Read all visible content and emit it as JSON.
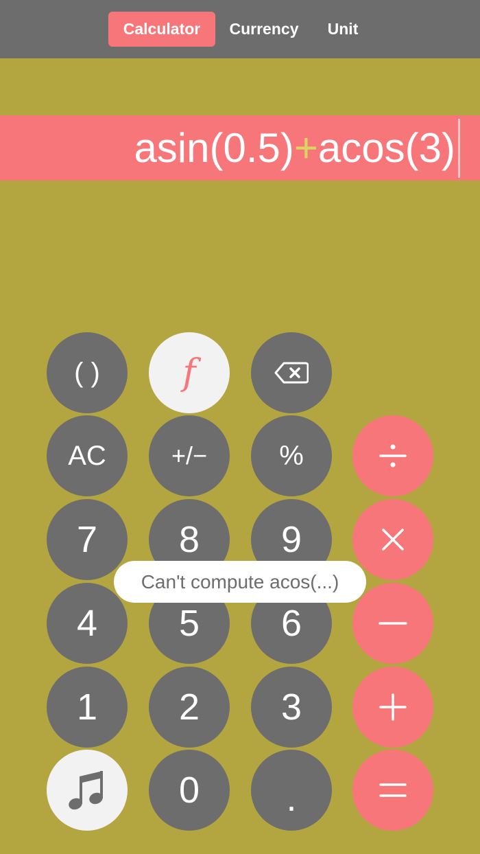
{
  "tabs": [
    {
      "label": "Calculator",
      "active": true
    },
    {
      "label": "Currency",
      "active": false
    },
    {
      "label": "Unit",
      "active": false
    }
  ],
  "display": {
    "part1": "asin(0.5)",
    "operator": "+",
    "part2": "acos(3)"
  },
  "keys": {
    "parens": "( )",
    "function": "f",
    "clear": "AC",
    "plus_minus": "+/−",
    "percent": "%",
    "seven": "7",
    "eight": "8",
    "nine": "9",
    "four": "4",
    "five": "5",
    "six": "6",
    "one": "1",
    "two": "2",
    "three": "3",
    "zero": "0",
    "decimal": "."
  },
  "toast": "Can't compute acos(...)",
  "colors": {
    "background": "#b3a641",
    "topbar": "#6d6d6d",
    "accent": "#f6767a",
    "key": "#6d6d6d",
    "light_key": "#f2f2f2",
    "operator_text": "#d9d463"
  },
  "icons": {
    "backspace": "backspace-icon",
    "divide": "divide-icon",
    "multiply": "multiply-icon",
    "minus": "minus-icon",
    "plus": "plus-icon",
    "equals": "equals-icon",
    "music": "music-note-icon"
  }
}
